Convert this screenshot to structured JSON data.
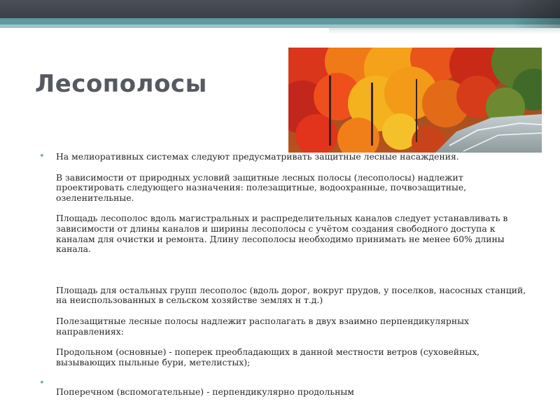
{
  "slide": {
    "title": "Лесополосы",
    "accent_color": "#5e9aa0",
    "bullet_glyph": "•"
  },
  "photo": {
    "icon": "autumn-forest-photo"
  },
  "content": {
    "item1": {
      "p1": "На мелиоративных системах следуют предусматривать защитные лесные насаждения.",
      "p2": "В зависимости от природных условий защитные лесных полосы (лесополосы) надлежит проектировать следующего назначения: полезащитные, водоохранные, почвозащитные, озеленительные.",
      "p3": "Площадь лесополос вдоль магистральных и распределительных каналов следует устанавливать в зависимости от длины каналов и ширины лесополосы с учётом создания свободного доступа к каналам для очистки и ремонта. Длину лесополосы необходимо принимать не менее 60% длины канала.",
      "p4": "Площадь для остальных групп лесополос (вдоль дорог, вокруг прудов, у поселков, насосных станций, на неиспользованных в сельском хозяйстве землях н т.д.)",
      "p5": "Полезащитные лесные полосы надлежит располагать в двух взаимно перпендикулярных направлениях:",
      "p6": "Продольном (основные) - поперек преобладающих в данной местности ветров (суховейных, вызывающих пыльные бури, метелистых);"
    },
    "item2": {
      "p1": "Поперечном (вспомогательные) - перпендикулярно продольным"
    }
  }
}
